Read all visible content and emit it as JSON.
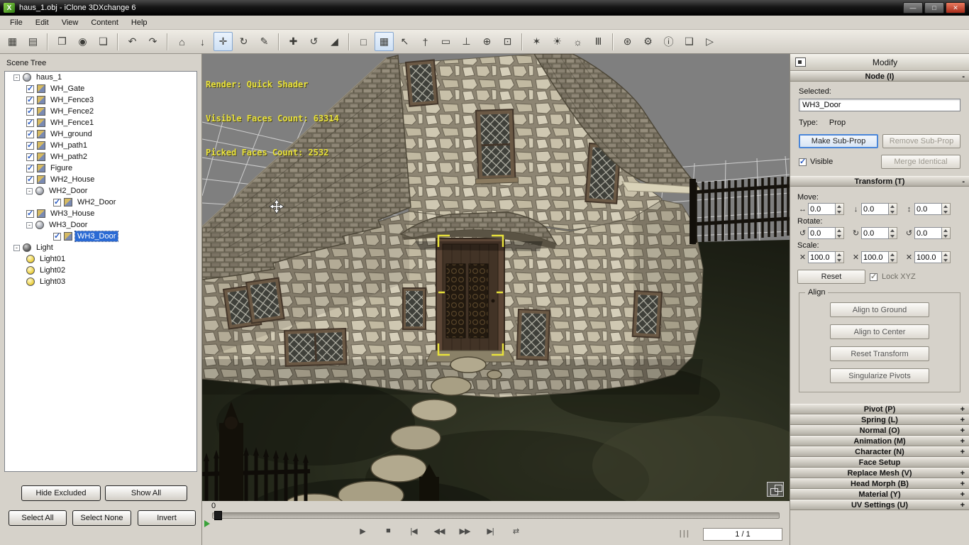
{
  "window": {
    "title": "haus_1.obj - iClone 3DXchange 6",
    "minimize": "—",
    "maximize": "□",
    "close": "✕",
    "logo_letter": "X"
  },
  "menu": [
    "File",
    "Edit",
    "View",
    "Content",
    "Help"
  ],
  "toolbar": {
    "buttons": [
      {
        "name": "scene-manager",
        "glyph": "▦"
      },
      {
        "name": "open-file",
        "glyph": "▤"
      },
      {
        "name": "import-model",
        "glyph": "❐",
        "sep_before": true
      },
      {
        "name": "preview-model",
        "glyph": "◉"
      },
      {
        "name": "export-model",
        "glyph": "❏"
      },
      {
        "name": "undo",
        "glyph": "↶",
        "sep_before": true
      },
      {
        "name": "redo",
        "glyph": "↷"
      },
      {
        "name": "home-camera",
        "glyph": "⌂",
        "sep_before": true
      },
      {
        "name": "pan-camera",
        "glyph": "↓"
      },
      {
        "name": "move-tool",
        "glyph": "✛",
        "active": true
      },
      {
        "name": "orbit-camera",
        "glyph": "↻"
      },
      {
        "name": "pick-tool",
        "glyph": "✎"
      },
      {
        "name": "translate-gizmo",
        "glyph": "✚",
        "sep_before": true
      },
      {
        "name": "rotate-gizmo",
        "glyph": "↺"
      },
      {
        "name": "scale-gizmo",
        "glyph": "◢"
      },
      {
        "name": "marquee-select",
        "glyph": "□",
        "sep_before": true
      },
      {
        "name": "grid-toggle",
        "glyph": "▦",
        "active": true
      },
      {
        "name": "pointer-axis",
        "glyph": "↖"
      },
      {
        "name": "pin-tool",
        "glyph": "†"
      },
      {
        "name": "plane-tool",
        "glyph": "▭"
      },
      {
        "name": "drop-to-floor",
        "glyph": "⊥"
      },
      {
        "name": "sphere-mode",
        "glyph": "⊕"
      },
      {
        "name": "focus-selected",
        "glyph": "⊡"
      },
      {
        "name": "auto-light",
        "glyph": "✶",
        "sep_before": true
      },
      {
        "name": "key-light",
        "glyph": "☀"
      },
      {
        "name": "brightness",
        "glyph": "☼"
      },
      {
        "name": "stage-mode",
        "glyph": "Ⅲ"
      },
      {
        "name": "world-globe",
        "glyph": "⊛",
        "sep_before": true
      },
      {
        "name": "tools-wrench",
        "glyph": "⚙"
      },
      {
        "name": "material-info",
        "glyph": "ⓘ"
      },
      {
        "name": "duplicate",
        "glyph": "❑"
      },
      {
        "name": "send-to-iclone",
        "glyph": "▷"
      }
    ]
  },
  "scene_tree": {
    "title": "Scene Tree",
    "expander_sign": "-",
    "items": [
      {
        "label": "haus_1",
        "level": 0,
        "exp": true,
        "icon": "globe"
      },
      {
        "label": "WH_Gate",
        "level": 1,
        "check": true,
        "icon": "mesh"
      },
      {
        "label": "WH_Fence3",
        "level": 1,
        "check": true,
        "icon": "mesh"
      },
      {
        "label": "WH_Fence2",
        "level": 1,
        "check": true,
        "icon": "mesh"
      },
      {
        "label": "WH_Fence1",
        "level": 1,
        "check": true,
        "icon": "mesh"
      },
      {
        "label": "WH_ground",
        "level": 1,
        "check": true,
        "icon": "mesh"
      },
      {
        "label": "WH_path1",
        "level": 1,
        "check": true,
        "icon": "mesh"
      },
      {
        "label": "WH_path2",
        "level": 1,
        "check": true,
        "icon": "mesh"
      },
      {
        "label": "Figure",
        "level": 1,
        "check": true,
        "icon": "mesh"
      },
      {
        "label": "WH2_House",
        "level": 1,
        "check": true,
        "icon": "mesh"
      },
      {
        "label": "WH2_Door",
        "level": 1,
        "exp": true,
        "icon": "globe"
      },
      {
        "label": "WH2_Door",
        "level": 2,
        "check": true,
        "icon": "mesh"
      },
      {
        "label": "WH3_House",
        "level": 1,
        "check": true,
        "icon": "mesh"
      },
      {
        "label": "WH3_Door",
        "level": 1,
        "exp": true,
        "icon": "globe"
      },
      {
        "label": "WH3_Door",
        "level": 2,
        "check": true,
        "icon": "mesh",
        "selected": true
      },
      {
        "label": "Light",
        "level": 0,
        "exp": true,
        "icon": "sphere-dark"
      },
      {
        "label": "Light01",
        "level": 1,
        "icon": "bulb"
      },
      {
        "label": "Light02",
        "level": 1,
        "icon": "bulb"
      },
      {
        "label": "Light03",
        "level": 1,
        "icon": "bulb"
      }
    ],
    "buttons": {
      "hide_excluded": "Hide Excluded",
      "show_all": "Show All",
      "select_all": "Select All",
      "select_none": "Select None",
      "invert": "Invert"
    }
  },
  "viewport": {
    "overlay_lines": [
      "Render: Quick Shader",
      "Visible Faces Count: 63314",
      "Picked Faces Count: 2532"
    ]
  },
  "modify": {
    "title": "Modify",
    "node": {
      "header": "Node (I)",
      "sign": "-",
      "selected_label": "Selected:",
      "selected_value": "WH3_Door",
      "type_label": "Type:",
      "type_value": "Prop",
      "make_subprop": "Make Sub-Prop",
      "remove_subprop": "Remove Sub-Prop",
      "visible_label": "Visible",
      "merge_identical": "Merge Identical"
    },
    "transform": {
      "header": "Transform (T)",
      "sign": "-",
      "move_label": "Move:",
      "rotate_label": "Rotate:",
      "scale_label": "Scale:",
      "move": {
        "icons": [
          "↔",
          "↓",
          "↕"
        ],
        "values": [
          "0.0",
          "0.0",
          "0.0"
        ]
      },
      "rotate": {
        "icons": [
          "↺",
          "↻",
          "↺"
        ],
        "values": [
          "0.0",
          "0.0",
          "0.0"
        ]
      },
      "scale": {
        "icons": [
          "✕",
          "✕",
          "✕"
        ],
        "values": [
          "100.0",
          "100.0",
          "100.0"
        ]
      },
      "reset_label": "Reset",
      "lock_label": "Lock XYZ",
      "align_title": "Align",
      "align_buttons": [
        "Align to Ground",
        "Align to Center",
        "Reset Transform",
        "Singularize Pivots"
      ]
    },
    "collapsed_sections": [
      {
        "label": "Pivot (P)",
        "sign": "+"
      },
      {
        "label": "Spring (L)",
        "sign": "+"
      },
      {
        "label": "Normal (O)",
        "sign": "+"
      },
      {
        "label": "Animation (M)",
        "sign": "+"
      },
      {
        "label": "Character (N)",
        "sign": "+"
      },
      {
        "label": "Face Setup",
        "sign": ""
      },
      {
        "label": "Replace Mesh (V)",
        "sign": "+"
      },
      {
        "label": "Head Morph (B)",
        "sign": "+"
      },
      {
        "label": "Material (Y)",
        "sign": "+"
      },
      {
        "label": "UV Settings (U)",
        "sign": "+"
      }
    ]
  },
  "timeline": {
    "start_frame": "0",
    "frame_display": "1 / 1",
    "grip": "|||",
    "transport": [
      {
        "name": "play",
        "glyph": "▶"
      },
      {
        "name": "stop",
        "glyph": "■"
      },
      {
        "name": "go-first",
        "glyph": "|◀"
      },
      {
        "name": "prev-frame",
        "glyph": "◀◀"
      },
      {
        "name": "next-frame",
        "glyph": "▶▶"
      },
      {
        "name": "go-last",
        "glyph": "▶|"
      },
      {
        "name": "loop",
        "glyph": "⇄"
      }
    ]
  },
  "colors": {
    "selection_blue": "#2a6ad4",
    "overlay_yellow": "#e9e23c",
    "viewport_gray": "#7f7f7f",
    "panel_gray": "#d6d2ca",
    "selection_brackets": "#e8e23c"
  }
}
